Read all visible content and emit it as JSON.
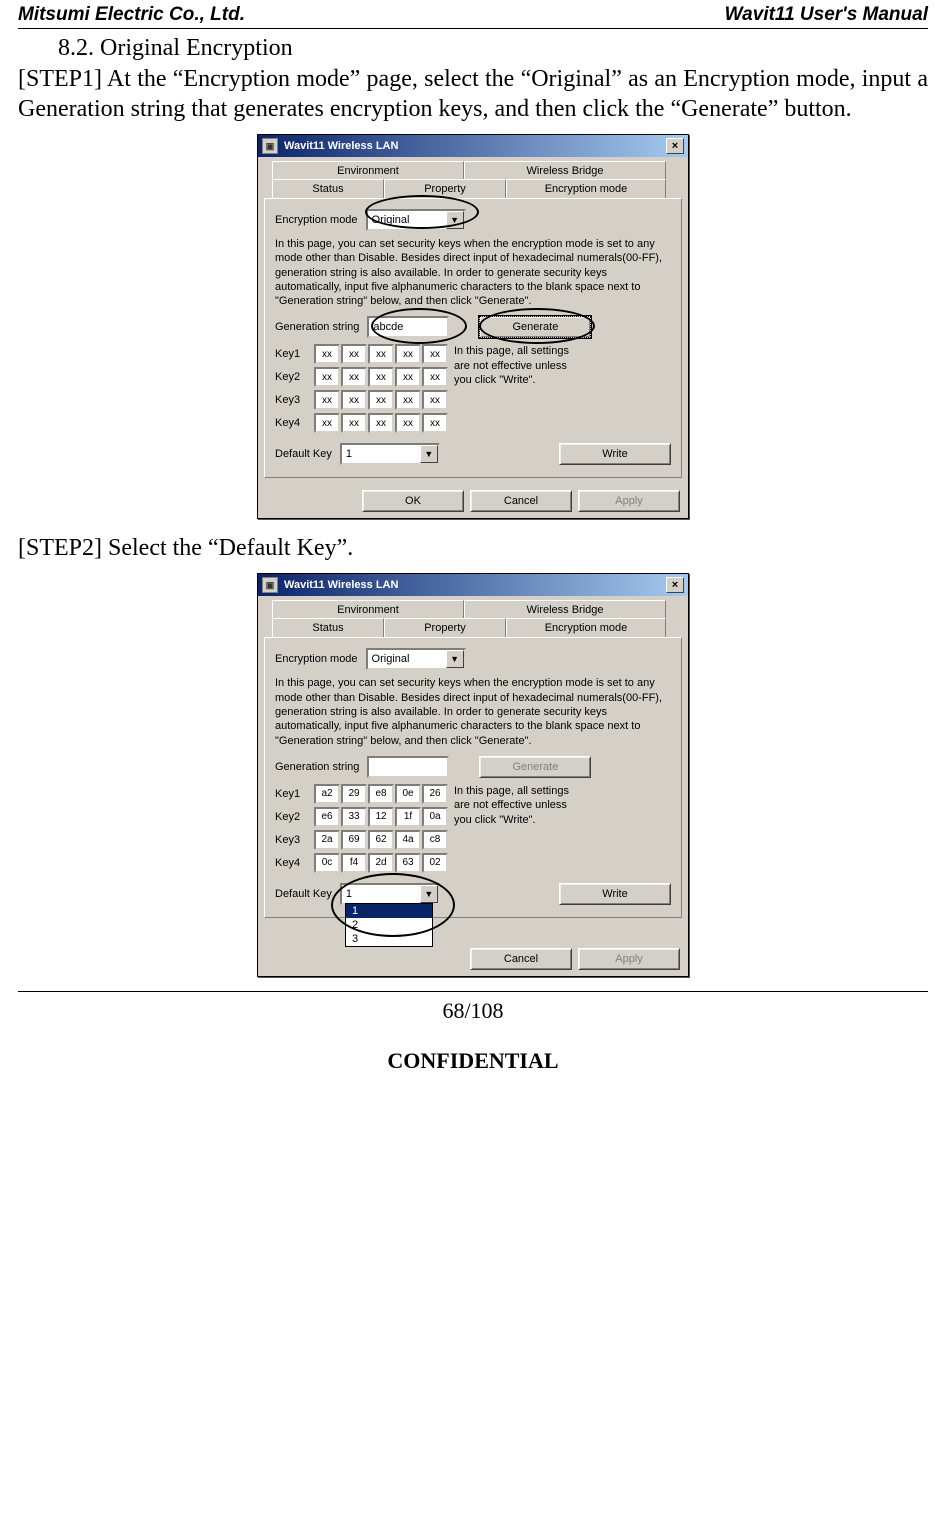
{
  "header": {
    "left": "Mitsumi Electric Co., Ltd.",
    "right": "Wavit11 User's Manual"
  },
  "section": "8.2. Original Encryption",
  "para1": "[STEP1] At the “Encryption mode” page, select the “Original” as an Encryption mode, input a Generation string that generates encryption keys, and then  click the “Generate” button.",
  "para2": "[STEP2] Select the “Default Key”.",
  "page_num": "68/108",
  "confidential": "CONFIDENTIAL",
  "dialog": {
    "title": "Wavit11 Wireless LAN",
    "tabs": {
      "env": "Environment",
      "wb": "Wireless Bridge",
      "status": "Status",
      "prop": "Property",
      "enc": "Encryption mode"
    },
    "enc_label": "Encryption mode",
    "enc_value": "Original",
    "desc": "In this page, you can set security keys when the encryption mode is set to any mode other than Disable. Besides direct input of hexadecimal numerals(00-FF), generation string is also available. In order to generate security keys automatically, input five alphanumeric characters to the blank space next to \"Generation string\" below, and then click \"Generate\".",
    "gen_label": "Generation string",
    "generate": "Generate",
    "note": "In this page, all settings are not effective unless you click \"Write\".",
    "key_labels": [
      "Key1",
      "Key2",
      "Key3",
      "Key4"
    ],
    "default_key_label": "Default Key",
    "default_key_value": "1",
    "write": "Write",
    "ok": "OK",
    "cancel": "Cancel",
    "apply": "Apply"
  },
  "shot1": {
    "gen_value": "abcde",
    "keys": [
      [
        "xx",
        "xx",
        "xx",
        "xx",
        "xx"
      ],
      [
        "xx",
        "xx",
        "xx",
        "xx",
        "xx"
      ],
      [
        "xx",
        "xx",
        "xx",
        "xx",
        "xx"
      ],
      [
        "xx",
        "xx",
        "xx",
        "xx",
        "xx"
      ]
    ]
  },
  "shot2": {
    "gen_value": "",
    "keys": [
      [
        "a2",
        "29",
        "e8",
        "0e",
        "26"
      ],
      [
        "e6",
        "33",
        "12",
        "1f",
        "0a"
      ],
      [
        "2a",
        "69",
        "62",
        "4a",
        "c8"
      ],
      [
        "0c",
        "f4",
        "2d",
        "63",
        "02"
      ]
    ],
    "dropdown_items": [
      "1",
      "2",
      "3"
    ]
  }
}
